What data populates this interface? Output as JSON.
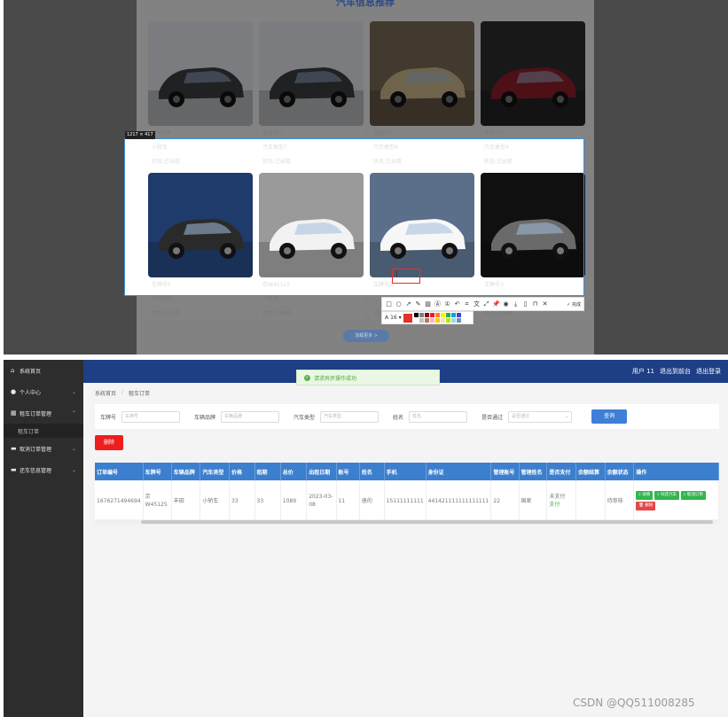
{
  "top": {
    "heading": "汽车信息推荐",
    "selection_size": "1217 × 417",
    "load_more": "加载更多 >",
    "cars": [
      {
        "plate": "车牌号8",
        "type": "",
        "status": ""
      },
      {
        "plate": "车牌号7",
        "type": "",
        "status": ""
      },
      {
        "plate": "车牌号6",
        "type": "",
        "status": ""
      },
      {
        "plate": "车牌号4",
        "type": "",
        "status": ""
      },
      {
        "plate": "",
        "type": "小轿车",
        "status": "状态:已出租"
      },
      {
        "plate": "",
        "type": "汽车类型7",
        "status": "状态:已出租"
      },
      {
        "plate": "",
        "type": "汽车类型6",
        "status": "状态:已出租"
      },
      {
        "plate": "",
        "type": "汽车类型4",
        "status": "状态:已出租"
      },
      {
        "plate": "车牌号5",
        "type": "汽车类型",
        "status": "状态:已出租"
      },
      {
        "plate": "京W45125",
        "type": "小轿车",
        "status": "状态:已出租"
      },
      {
        "plate": "车牌号2",
        "type": "",
        "status": "状态:已出租"
      },
      {
        "plate": "车牌号3",
        "type": "",
        "status": "状态:已出租"
      }
    ],
    "toolbar": {
      "done": "完成",
      "font_size": "16",
      "text_tool": "A"
    }
  },
  "colors": {
    "selection": "#3b8fd9",
    "header": "#1e3e85",
    "primary": "#3f7fd6",
    "danger": "#ee1e1e",
    "success": "#33b64d"
  },
  "sidebar": {
    "items": [
      {
        "icon": "home-icon",
        "label": "系统首页"
      },
      {
        "icon": "user-icon",
        "label": "个人中心"
      },
      {
        "icon": "grid-icon",
        "label": "租车订单管理"
      },
      {
        "icon": "tv-icon",
        "label": "取消订单管理"
      },
      {
        "icon": "tv-icon",
        "label": "还车信息管理"
      }
    ],
    "sub_item": "租车订单"
  },
  "header": {
    "user": "用户 11",
    "back_front": "退出到前台",
    "logout": "退出登录"
  },
  "toast": {
    "message": "请求异步操作成功"
  },
  "breadcrumb": {
    "home": "系统首页",
    "current": "租车订单"
  },
  "search": {
    "fields": [
      {
        "label": "车牌号",
        "placeholder": "车牌号"
      },
      {
        "label": "车辆品牌",
        "placeholder": "车辆品牌"
      },
      {
        "label": "汽车类型",
        "placeholder": "汽车类型"
      },
      {
        "label": "姓名",
        "placeholder": "姓名"
      }
    ],
    "approval_label": "是否通过",
    "approval_placeholder": "是否通过",
    "query_button": "查询"
  },
  "actions": {
    "delete": "删除"
  },
  "table": {
    "headers": [
      "订单编号",
      "车牌号",
      "车辆品牌",
      "汽车类型",
      "价格",
      "租期",
      "总价",
      "出租日期",
      "账号",
      "姓名",
      "手机",
      "身份证",
      "管理账号",
      "管理姓名",
      "是否支付",
      "余额结算",
      "余额状态",
      "操作"
    ],
    "row": {
      "order_no": "1676271494694",
      "plate": "京W45125",
      "brand": "丰田",
      "type": "小轿车",
      "price": "33",
      "term": "33",
      "total": "1089",
      "date": "2023-03-08",
      "account": "11",
      "name": "册的",
      "phone": "15111111111",
      "id_card": "441421111111111111",
      "admin_account": "22",
      "admin_name": "国家",
      "pay_status": "未支付",
      "pay_link": "支付",
      "balance": "",
      "balance_status": "待审核"
    },
    "row_buttons": {
      "detail": "详情",
      "return": "归还汽车",
      "cancel": "取消订单",
      "delete": "删除"
    }
  },
  "watermark": "CSDN @QQ511008285"
}
